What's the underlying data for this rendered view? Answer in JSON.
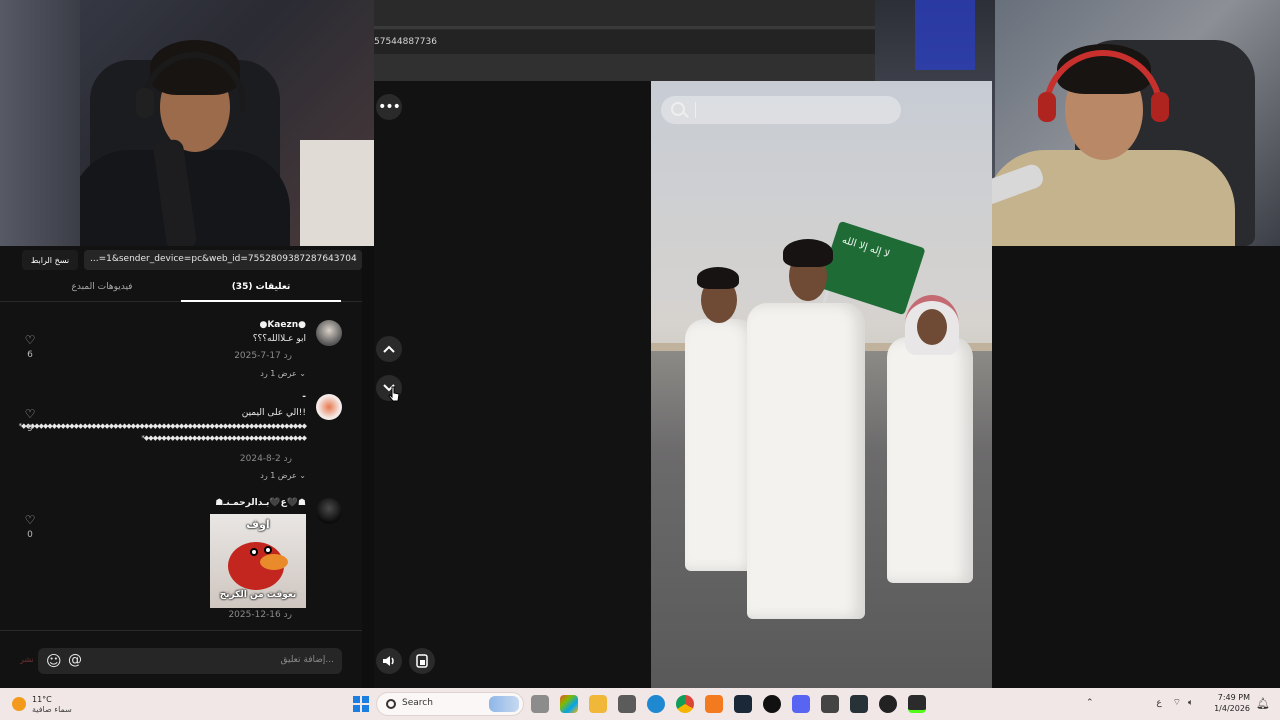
{
  "browser": {
    "url_fragment": "57544887736"
  },
  "panel": {
    "copy_link_label": "نسخ الرابط",
    "link_value": "...=1&sender_device=pc&web_id=7552809387287643704",
    "tabs": {
      "comments": "(35) تعليقات",
      "creator_videos": "فيديوهات المبدع"
    },
    "comments": [
      {
        "username": "●Kaezn●",
        "text": "ابو عـلاالله؟؟؟",
        "date": "2025-7-17",
        "reply_label": "رد",
        "view_replies": "عرض 1 رد",
        "likes": "6"
      },
      {
        "username": "-",
        "text": "الي على اليمين!!",
        "text_line2": "*◆◆◆◆◆◆◆◆◆◆◆◆◆◆◆◆◆◆◆◆◆◆◆◆◆◆◆◆◆◆◆◆◆◆◆◆◆◆◆◆◆◆◆◆◆◆◆◆◆◆◆◆◆◆◆◆◆◆◆◆◆◆◆◆◆",
        "text_line3": "*◆◆◆◆◆◆◆◆◆◆◆◆◆◆◆◆◆◆◆◆◆◆◆◆◆◆◆◆◆◆◆◆◆◆◆◆◆",
        "date": "2024-8-2",
        "reply_label": "رد",
        "view_replies": "عرض 1 رد",
        "likes": "9"
      },
      {
        "username": "☗ع🖤بـدالرحمـنـ🖤☗",
        "sticker_top": "اوف",
        "sticker_bottom": "تعوقت من الكرنج",
        "date": "2025-12-16",
        "reply_label": "رد",
        "likes": "0"
      }
    ],
    "compose_placeholder": "إضافة تعليق...",
    "send_label": "نشر"
  },
  "taskbar": {
    "temperature": "11°C",
    "condition": "سماء صافية",
    "search_label": "Search",
    "tray_lang": "ع",
    "time": "7:49 PM",
    "date": "1/4/2026"
  },
  "colors": {
    "accent_blue": "#1b7ee0",
    "panel_bg": "#121212",
    "taskbar_bg": "#f1e7e7"
  }
}
